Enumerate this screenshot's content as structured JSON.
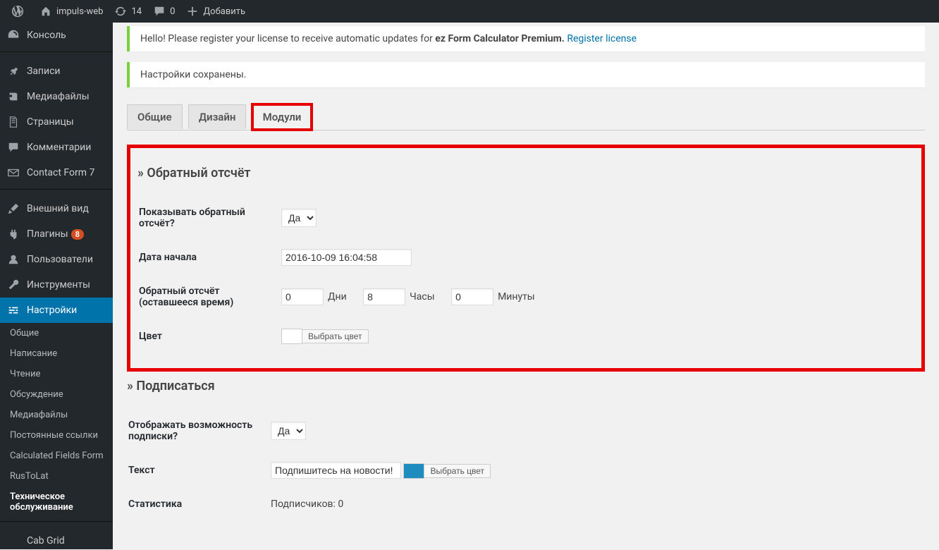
{
  "adminbar": {
    "site": "impuls-web",
    "updates": "14",
    "comments": "0",
    "add": "Добавить"
  },
  "sidebar": {
    "items": [
      {
        "label": "Консоль"
      },
      {
        "label": "Записи"
      },
      {
        "label": "Медиафайлы"
      },
      {
        "label": "Страницы"
      },
      {
        "label": "Комментарии"
      },
      {
        "label": "Contact Form 7"
      },
      {
        "label": "Внешний вид"
      },
      {
        "label": "Плагины",
        "badge": "8"
      },
      {
        "label": "Пользователи"
      },
      {
        "label": "Инструменты"
      },
      {
        "label": "Настройки"
      }
    ],
    "subs": [
      {
        "label": "Общие"
      },
      {
        "label": "Написание"
      },
      {
        "label": "Чтение"
      },
      {
        "label": "Обсуждение"
      },
      {
        "label": "Медиафайлы"
      },
      {
        "label": "Постоянные ссылки"
      },
      {
        "label": "Calculated Fields Form"
      },
      {
        "label": "RusToLat"
      },
      {
        "label": "Техническое обслуживание"
      }
    ],
    "cab": "Cab Grid"
  },
  "notices": {
    "license_pre": "Hello! Please register your license to receive automatic updates for ",
    "license_bold": "ez Form Calculator Premium.",
    "license_link": "Register license",
    "saved": "Настройки сохранены."
  },
  "tabs": {
    "t1": "Общие",
    "t2": "Дизайн",
    "t3": "Модули"
  },
  "countdown": {
    "title": "» Обратный отсчёт",
    "show_label": "Показывать обратный отсчёт?",
    "show_val": "Да",
    "date_label": "Дата начала",
    "date_val": "2016-10-09 16:04:58",
    "remain_label": "Обратный отсчёт (оставшееся время)",
    "days_val": "0",
    "days_lbl": "Дни",
    "hours_val": "8",
    "hours_lbl": "Часы",
    "mins_val": "0",
    "mins_lbl": "Минуты",
    "color_label": "Цвет",
    "color_btn": "Выбрать цвет"
  },
  "subscribe": {
    "title": "» Подписаться",
    "show_label": "Отображать возможность подписки?",
    "show_val": "Да",
    "text_label": "Текст",
    "text_val": "Подпишитесь на новости!",
    "color_btn": "Выбрать цвет",
    "stats_label": "Статистика",
    "stats_val": "Подписчиков: 0"
  }
}
